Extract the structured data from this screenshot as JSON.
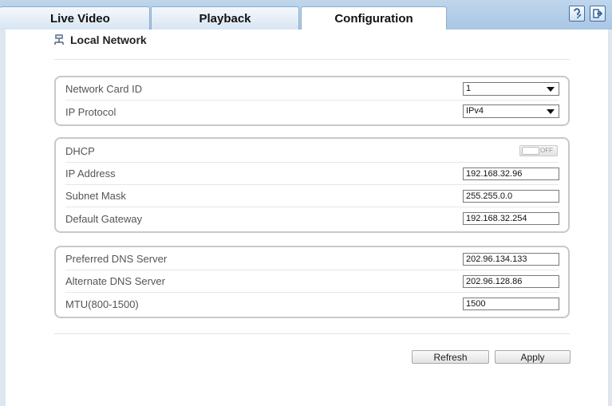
{
  "tabs": [
    {
      "label": "Live Video"
    },
    {
      "label": "Playback"
    },
    {
      "label": "Configuration",
      "active": true
    }
  ],
  "toolbar": {
    "help_icon": "edit-help-icon",
    "exit_icon": "logout-icon"
  },
  "section": {
    "title": "Local Network",
    "icon": "network-icon"
  },
  "network": {
    "card_id_label": "Network Card ID",
    "card_id_value": "1",
    "protocol_label": "IP Protocol",
    "protocol_value": "IPv4"
  },
  "ip": {
    "dhcp_label": "DHCP",
    "dhcp_state": "OFF",
    "address_label": "IP Address",
    "address_value": "192.168.32.96",
    "mask_label": "Subnet Mask",
    "mask_value": "255.255.0.0",
    "gateway_label": "Default Gateway",
    "gateway_value": "192.168.32.254"
  },
  "dns": {
    "preferred_label": "Preferred DNS Server",
    "preferred_value": "202.96.134.133",
    "alternate_label": "Alternate DNS Server",
    "alternate_value": "202.96.128.86",
    "mtu_label": "MTU(800-1500)",
    "mtu_value": "1500"
  },
  "buttons": {
    "refresh": "Refresh",
    "apply": "Apply"
  },
  "colors": {
    "tabbar": "#b3cde8",
    "page_bg": "#dfe6ee",
    "panel": "#ffffff",
    "accent": "#3e6fa8"
  }
}
